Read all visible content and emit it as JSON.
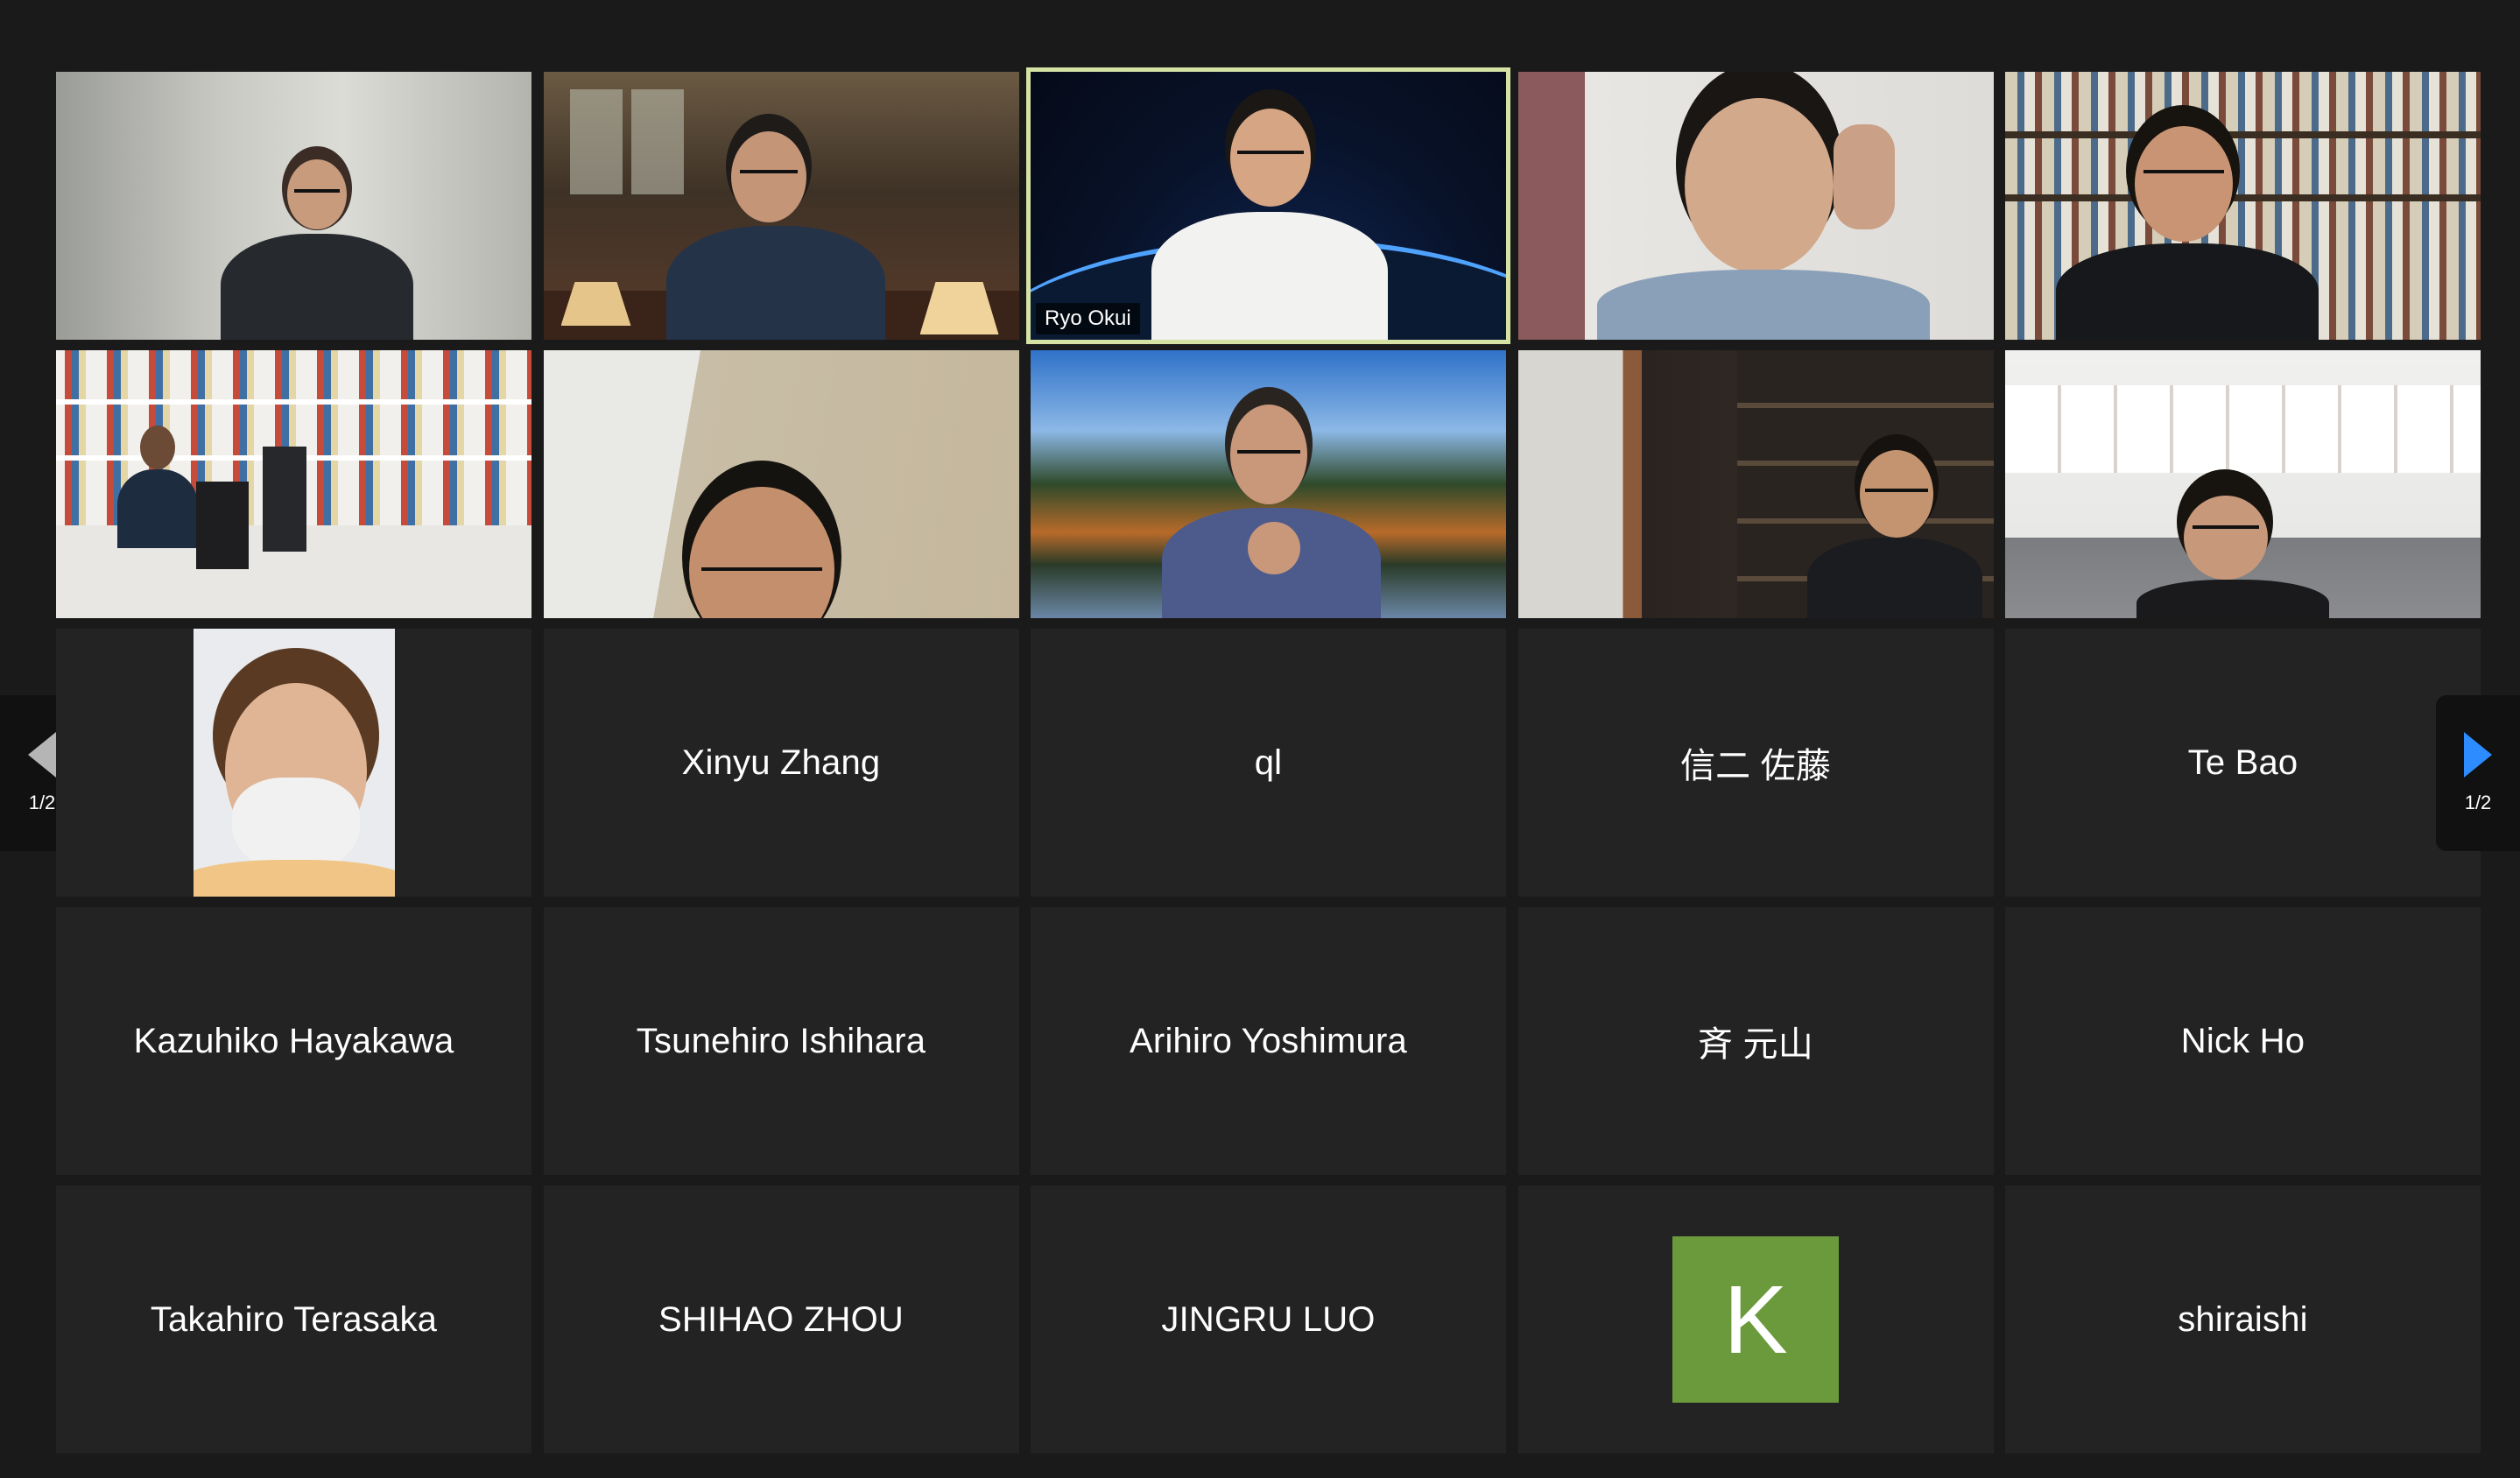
{
  "meeting": {
    "page_indicator_left": "1/2",
    "page_indicator_right": "1/2"
  },
  "tiles": [
    {
      "kind": "video",
      "scene": "blurred-office",
      "name_tag": ""
    },
    {
      "kind": "video",
      "scene": "library-hall",
      "name_tag": ""
    },
    {
      "kind": "video",
      "scene": "space-earth",
      "name_tag": "Ryo Okui",
      "active": true
    },
    {
      "kind": "video",
      "scene": "room-curtain",
      "name_tag": ""
    },
    {
      "kind": "video",
      "scene": "bookshelf",
      "name_tag": ""
    },
    {
      "kind": "video",
      "scene": "office-bookshelf-wide",
      "name_tag": ""
    },
    {
      "kind": "video",
      "scene": "plain-wall",
      "name_tag": ""
    },
    {
      "kind": "video",
      "scene": "autumn-lake",
      "name_tag": ""
    },
    {
      "kind": "video",
      "scene": "dark-bookshelf",
      "name_tag": ""
    },
    {
      "kind": "video",
      "scene": "lab-office",
      "name_tag": ""
    },
    {
      "kind": "video",
      "scene": "masked-portrait",
      "name_tag": ""
    },
    {
      "kind": "name",
      "name": "Xinyu Zhang"
    },
    {
      "kind": "name",
      "name": "ql"
    },
    {
      "kind": "name",
      "name": "信二 佐藤"
    },
    {
      "kind": "name",
      "name": "Te Bao"
    },
    {
      "kind": "name",
      "name": "Kazuhiko Hayakawa"
    },
    {
      "kind": "name",
      "name": "Tsunehiro Ishihara"
    },
    {
      "kind": "name",
      "name": "Arihiro Yoshimura"
    },
    {
      "kind": "name",
      "name": "斉 元山"
    },
    {
      "kind": "name",
      "name": "Nick Ho"
    },
    {
      "kind": "name",
      "name": "Takahiro Terasaka"
    },
    {
      "kind": "name",
      "name": "SHIHAO ZHOU"
    },
    {
      "kind": "name",
      "name": "JINGRU LUO"
    },
    {
      "kind": "avatar",
      "letter": "K",
      "color": "#6b9a3c"
    },
    {
      "kind": "name",
      "name": "shiraishi"
    }
  ],
  "colors": {
    "background": "#1a1a1a",
    "tile": "#232323",
    "active_border": "#d5e2a3",
    "next_arrow": "#2d8cff",
    "prev_arrow": "#b5b5b5"
  }
}
